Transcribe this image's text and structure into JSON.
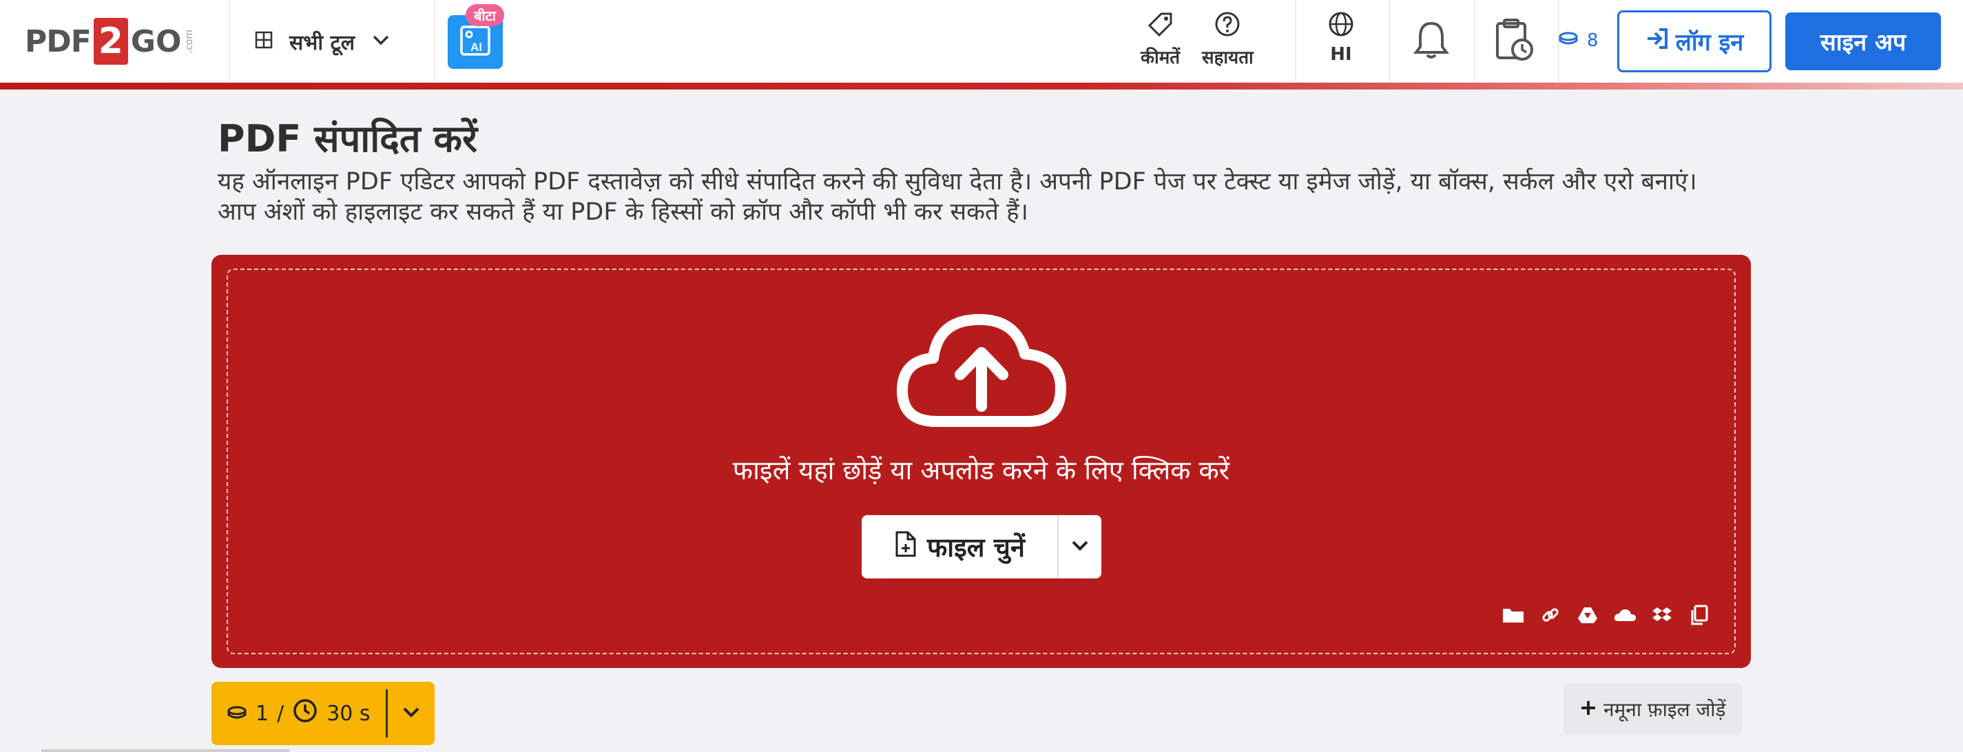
{
  "header": {
    "logo": {
      "pdf": "PDF",
      "two": "2",
      "go": "GO",
      "com": ".com"
    },
    "all_tools_label": "सभी टूल",
    "beta_badge": "बीटा",
    "pricing_label": "कीमतें",
    "help_label": "सहायता",
    "language_label": "HI",
    "credits_count": "8",
    "login_label": "लॉग इन",
    "signup_label": "साइन अप"
  },
  "main": {
    "title": "PDF संपादित करें",
    "description_line1": "यह ऑनलाइन PDF एडिटर आपको PDF दस्तावेज़ को सीधे संपादित करने की सुविधा देता है। अपनी PDF पेज पर टेक्स्ट या इमेज जोड़ें, या बॉक्स, सर्कल और एरो बनाएं।",
    "description_line2": "आप अंशों को हाइलाइट कर सकते हैं या PDF के हिस्सों को क्रॉप और कॉपी भी कर सकते हैं।"
  },
  "upload": {
    "drop_text": "फाइलें यहां छोड़ें या अपलोड करने के लिए क्लिक करें",
    "choose_file_label": "फाइल चुनें",
    "source_icons": [
      "folder-icon",
      "link-icon",
      "google-drive-icon",
      "onedrive-icon",
      "dropbox-icon",
      "clipboard-icon"
    ]
  },
  "limits": {
    "credits": "1",
    "slash": "/",
    "time": "30 s"
  },
  "sample_file_label": "नमूना फ़ाइल जोड़ें",
  "colors": {
    "brand_red": "#b71c1c",
    "accent_blue": "#1e6fe0",
    "limits_yellow": "#f8b400",
    "beta_pink": "#f06292"
  }
}
